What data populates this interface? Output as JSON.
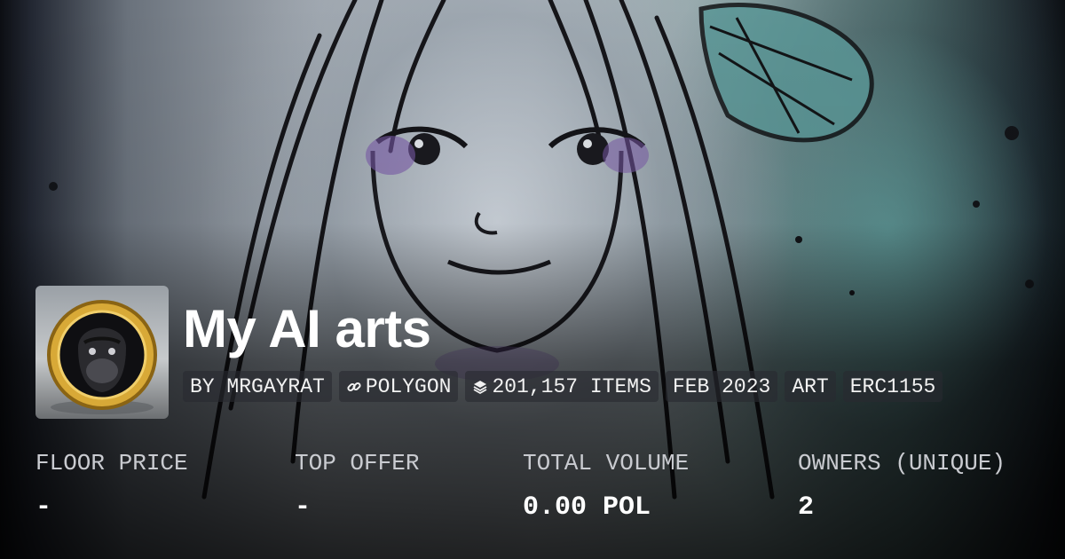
{
  "collection": {
    "title": "My AI arts",
    "avatar_icon": "gorilla-coin-icon"
  },
  "tags": [
    {
      "label": "BY MRGAYRAT"
    },
    {
      "label": "POLYGON",
      "icon": "chain-link-icon"
    },
    {
      "label": "201,157 ITEMS",
      "icon": "layers-icon"
    },
    {
      "label": "FEB 2023"
    },
    {
      "label": "ART"
    },
    {
      "label": "ERC1155"
    }
  ],
  "stats": [
    {
      "label": "FLOOR PRICE",
      "value": "-"
    },
    {
      "label": "TOP OFFER",
      "value": "-"
    },
    {
      "label": "TOTAL VOLUME",
      "value": "0.00 POL"
    },
    {
      "label": "OWNERS (UNIQUE)",
      "value": "2"
    }
  ],
  "colors": {
    "text": "#ffffff",
    "label": "#c9cbd0",
    "tag_bg": "#28292f",
    "accent_teal": "#5a9696",
    "accent_purple": "#7a5aa8"
  }
}
